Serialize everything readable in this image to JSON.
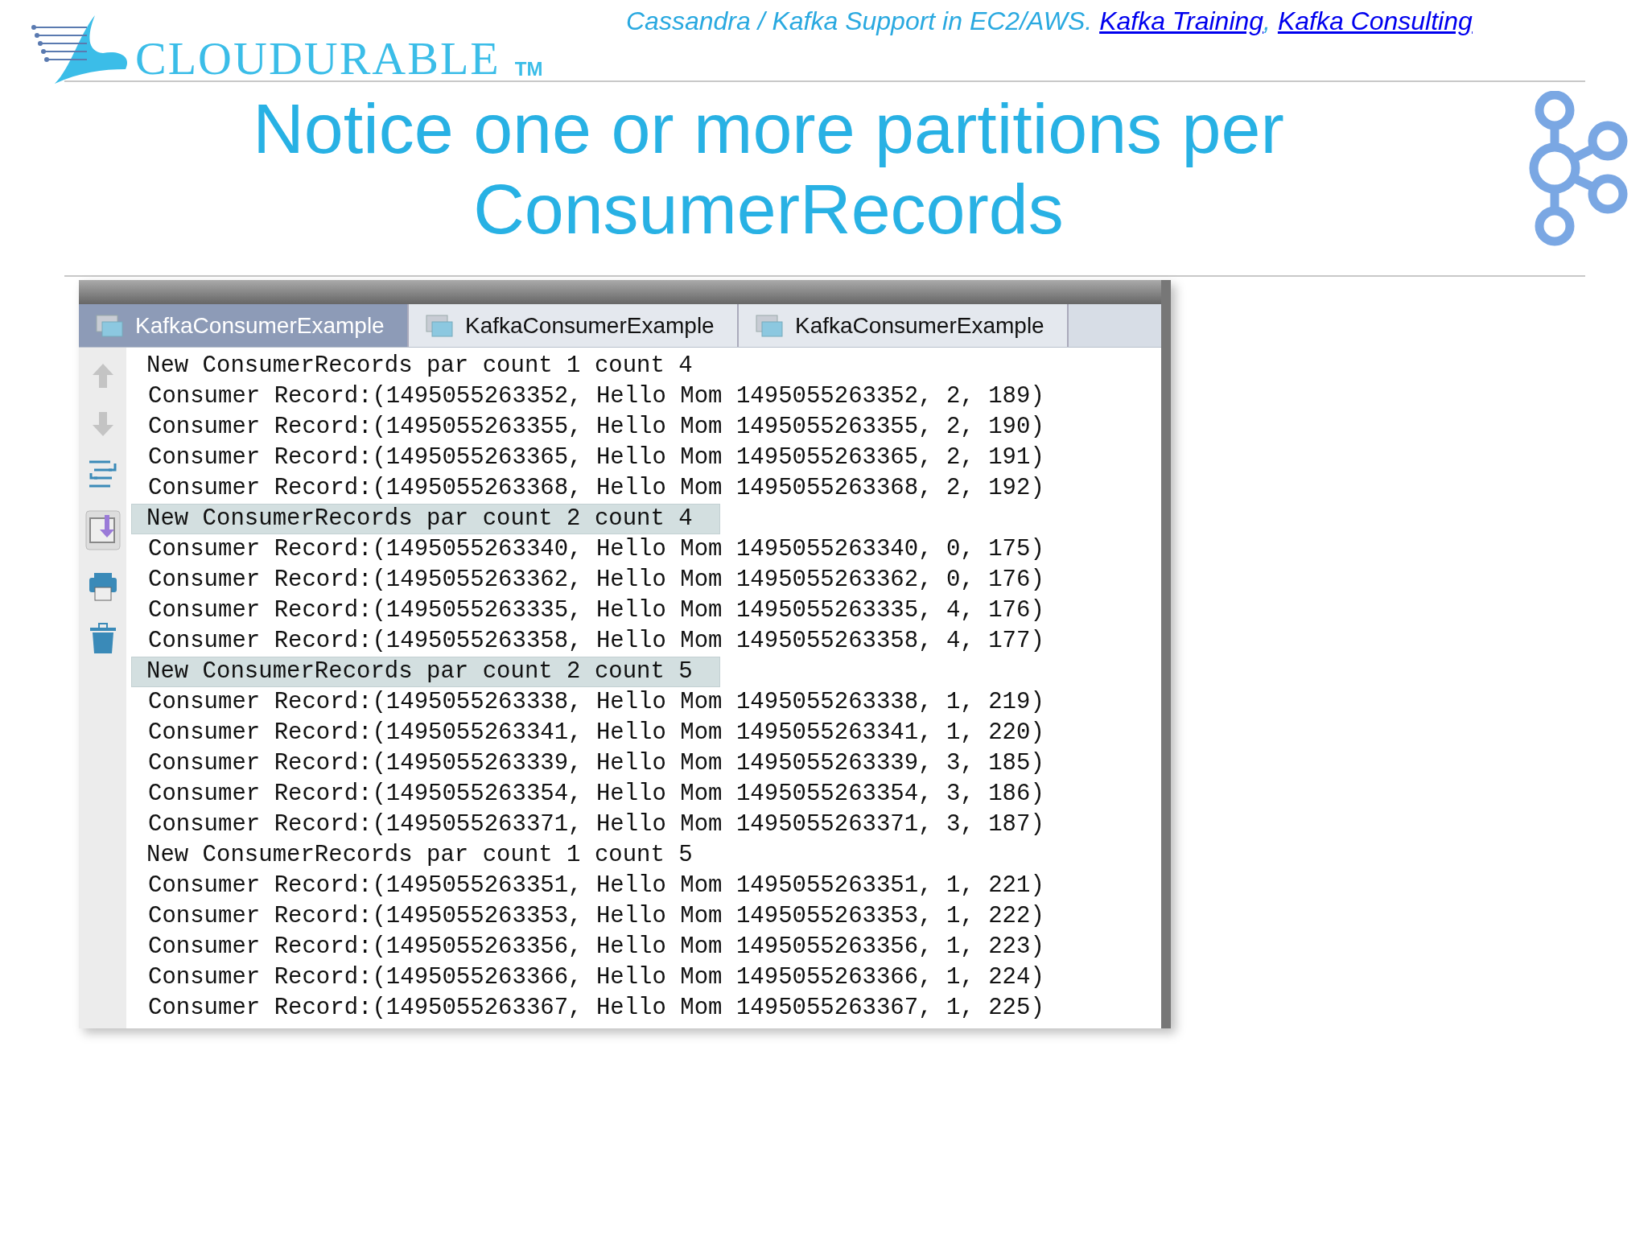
{
  "header": {
    "logo_text": "CLOUDURABLE",
    "logo_mark": "TM",
    "tagline": "Cassandra / Kafka Support in EC2/AWS.",
    "links": [
      {
        "label": "Kafka Training"
      },
      {
        "label": "Kafka Consulting"
      }
    ],
    "separator": ","
  },
  "title": "Notice one or more partitions per ConsumerRecords",
  "console": {
    "tabs": [
      {
        "label": "KafkaConsumerExample",
        "selected": true
      },
      {
        "label": "KafkaConsumerExample",
        "selected": false
      },
      {
        "label": "KafkaConsumerExample",
        "selected": false
      }
    ],
    "lines": [
      {
        "kind": "header",
        "text": "New ConsumerRecords par count 1 count 4",
        "highlighted": false
      },
      {
        "kind": "record",
        "text": "Consumer Record:(1495055263352, Hello Mom 1495055263352, 2, 189)",
        "highlighted": false
      },
      {
        "kind": "record",
        "text": "Consumer Record:(1495055263355, Hello Mom 1495055263355, 2, 190)",
        "highlighted": false
      },
      {
        "kind": "record",
        "text": "Consumer Record:(1495055263365, Hello Mom 1495055263365, 2, 191)",
        "highlighted": false
      },
      {
        "kind": "record",
        "text": "Consumer Record:(1495055263368, Hello Mom 1495055263368, 2, 192)",
        "highlighted": false
      },
      {
        "kind": "header",
        "text": "New ConsumerRecords par count 2 count 4",
        "highlighted": true
      },
      {
        "kind": "record",
        "text": "Consumer Record:(1495055263340, Hello Mom 1495055263340, 0, 175)",
        "highlighted": false
      },
      {
        "kind": "record",
        "text": "Consumer Record:(1495055263362, Hello Mom 1495055263362, 0, 176)",
        "highlighted": false
      },
      {
        "kind": "record",
        "text": "Consumer Record:(1495055263335, Hello Mom 1495055263335, 4, 176)",
        "highlighted": false
      },
      {
        "kind": "record",
        "text": "Consumer Record:(1495055263358, Hello Mom 1495055263358, 4, 177)",
        "highlighted": false
      },
      {
        "kind": "header",
        "text": "New ConsumerRecords par count 2 count 5",
        "highlighted": true
      },
      {
        "kind": "record",
        "text": "Consumer Record:(1495055263338, Hello Mom 1495055263338, 1, 219)",
        "highlighted": false
      },
      {
        "kind": "record",
        "text": "Consumer Record:(1495055263341, Hello Mom 1495055263341, 1, 220)",
        "highlighted": false
      },
      {
        "kind": "record",
        "text": "Consumer Record:(1495055263339, Hello Mom 1495055263339, 3, 185)",
        "highlighted": false
      },
      {
        "kind": "record",
        "text": "Consumer Record:(1495055263354, Hello Mom 1495055263354, 3, 186)",
        "highlighted": false
      },
      {
        "kind": "record",
        "text": "Consumer Record:(1495055263371, Hello Mom 1495055263371, 3, 187)",
        "highlighted": false
      },
      {
        "kind": "header",
        "text": "New ConsumerRecords par count 1 count 5",
        "highlighted": false
      },
      {
        "kind": "record",
        "text": "Consumer Record:(1495055263351, Hello Mom 1495055263351, 1, 221)",
        "highlighted": false
      },
      {
        "kind": "record",
        "text": "Consumer Record:(1495055263353, Hello Mom 1495055263353, 1, 222)",
        "highlighted": false
      },
      {
        "kind": "record",
        "text": "Consumer Record:(1495055263356, Hello Mom 1495055263356, 1, 223)",
        "highlighted": false
      },
      {
        "kind": "record",
        "text": "Consumer Record:(1495055263366, Hello Mom 1495055263366, 1, 224)",
        "highlighted": false
      },
      {
        "kind": "record",
        "text": "Consumer Record:(1495055263367, Hello Mom 1495055263367, 1, 225)",
        "highlighted": false
      }
    ]
  }
}
